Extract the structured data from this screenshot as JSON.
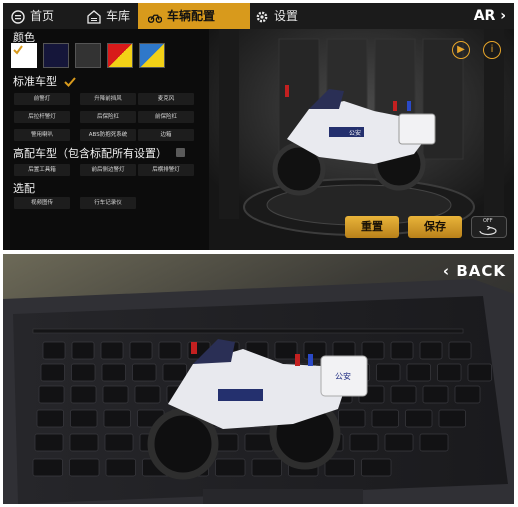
{
  "nav": {
    "home": "首页",
    "garage": "车库",
    "config": "车辆配置",
    "settings": "设置",
    "ar": "AR"
  },
  "sections": {
    "color": "颜色",
    "standard": "标准车型",
    "premium": "高配车型（包含标配所有设置）",
    "optional": "选配"
  },
  "colors": [
    "#ffffff",
    "#15163a",
    "#333333",
    "#d81a1a",
    "#1a6fc9"
  ],
  "colors_split": {
    "red_yellow": [
      "#d81a1a",
      "#f3d117"
    ],
    "blue_yellow": [
      "#2f78c9",
      "#f3d117"
    ]
  },
  "standard_options": [
    "前警灯",
    "升降前挡风",
    "麦克风",
    "后拉杆警灯",
    "后保险杠",
    "前保险杠",
    "警用喇叭",
    "ABS防抱死系统",
    "边箱"
  ],
  "premium_options": [
    "后置工具箱",
    "前后侧边警灯",
    "后横排警灯"
  ],
  "optional_options": [
    "视频图传",
    "行车记录仪"
  ],
  "buttons": {
    "reset": "重置",
    "save": "保存",
    "toggle": "OFF",
    "back": "BACK"
  },
  "bike_label": "公安",
  "accent": "#d89a1c"
}
